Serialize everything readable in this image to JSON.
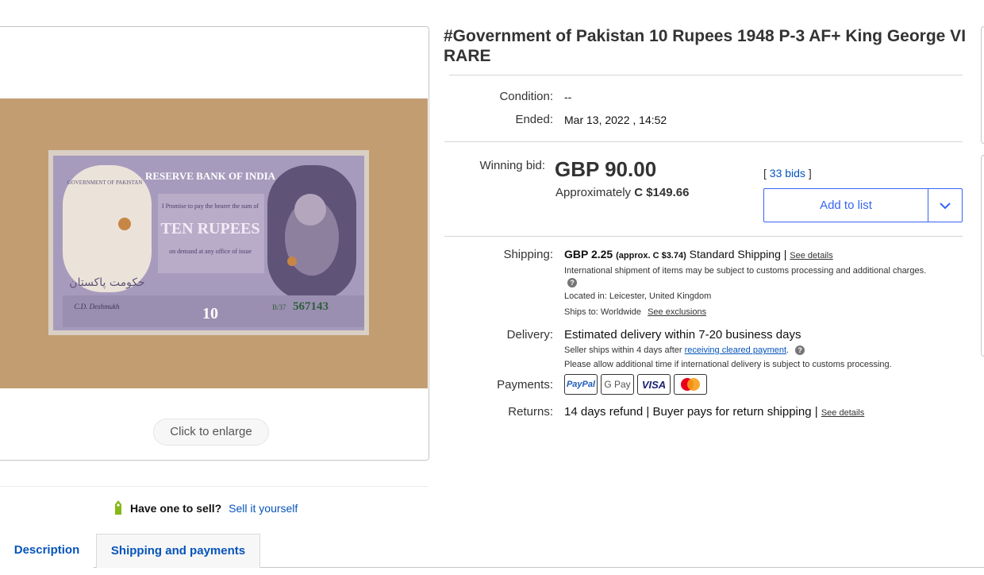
{
  "gallery": {
    "enlarge_label": "Click to enlarge"
  },
  "sell": {
    "question": "Have one to sell?",
    "link": "Sell it yourself"
  },
  "tabs": [
    {
      "label": "Description"
    },
    {
      "label": "Shipping and payments"
    }
  ],
  "item": {
    "title": "#Government of Pakistan 10 Rupees 1948 P-3 AF+ King George VI RARE",
    "condition_label": "Condition:",
    "condition_value": "--",
    "ended_label": "Ended:",
    "ended_value": "Mar 13, 2022 , 14:52"
  },
  "bid": {
    "label": "Winning bid:",
    "price": "GBP 90.00",
    "approx_prefix": "Approximately",
    "approx_value": "C $149.66",
    "bids_open": "[",
    "bids_link": "33 bids",
    "bids_close": "]",
    "add_to_list": "Add to list"
  },
  "shipping": {
    "label": "Shipping:",
    "price": "GBP 2.25",
    "approx": "(approx. C $3.74)",
    "method": "Standard Shipping",
    "separator": "|",
    "details_link": "See details",
    "intl_note": "International shipment of items may be subject to customs processing and additional charges.",
    "location_label": "Located in:",
    "location_value": "Leicester, United Kingdom",
    "ships_to_label": "Ships to:",
    "ships_to_value": "Worldwide",
    "exclusions_link": "See exclusions"
  },
  "delivery": {
    "label": "Delivery:",
    "estimate": "Estimated delivery within 7-20 business days",
    "ships_within": "Seller ships within 4 days after",
    "payment_link": "receiving cleared payment",
    "period": ".",
    "customs_note": "Please allow additional time if international delivery is subject to customs processing."
  },
  "payments": {
    "label": "Payments:",
    "methods": [
      "PayPal",
      "G Pay",
      "VISA",
      "Mastercard"
    ]
  },
  "returns": {
    "label": "Returns:",
    "policy": "14 days refund | Buyer pays for return shipping",
    "separator": "|",
    "details_link": "See details"
  },
  "banknote": {
    "bank": "RESERVE BANK OF INDIA",
    "issuer": "GOVERNMENT OF PAKISTAN",
    "promise": "I Promise to pay the bearer the sum of",
    "denomination": "TEN RUPEES",
    "payable": "on demand at any office of issue",
    "urdu": "حکومت پاکستان",
    "signature": "C.D. Deshmukh",
    "serial": "567143",
    "prefix": "B/37",
    "numeral": "10"
  },
  "colors": {
    "link_blue": "#0654ba",
    "accent_blue": "#3665f3",
    "note_violet": "#8c7fa8",
    "board_tan": "#c09a6f"
  }
}
